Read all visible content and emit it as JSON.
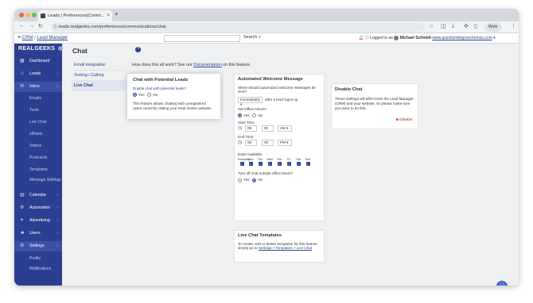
{
  "browser": {
    "tab_title": "Leads | Preferences|Comm...",
    "url": "leads.realgeeks.com/preferences/communications/chat",
    "profile_label": "Work"
  },
  "topbar": {
    "breadcrumb_root": "CRM",
    "breadcrumb_page": "Lead Manager",
    "search_label": "Search",
    "logged_in_label": "Logged in as",
    "user_name": "Michael Schmidt",
    "website": "www.quicklandingnerchomes.com"
  },
  "sidebar": {
    "logo": "REALGEEKS",
    "items": [
      {
        "label": "Dashboard",
        "icon": "dashboard-icon",
        "glyph": "▦"
      },
      {
        "label": "Leads",
        "icon": "person-icon",
        "glyph": "☺"
      },
      {
        "label": "Inbox",
        "icon": "inbox-icon",
        "glyph": "✉"
      }
    ],
    "inbox_sub": [
      "Emails",
      "Texts",
      "Live Chat",
      "eBlasts",
      "Videos",
      "Postcards",
      "Templates",
      "Message Settings"
    ],
    "items2": [
      {
        "label": "Calendar",
        "icon": "calendar-icon",
        "glyph": "▤"
      },
      {
        "label": "Automation",
        "icon": "automation-icon",
        "glyph": "⚙"
      },
      {
        "label": "Advertising",
        "icon": "advertising-icon",
        "glyph": "✦"
      },
      {
        "label": "Users",
        "icon": "users-icon",
        "glyph": "☻"
      },
      {
        "label": "Settings",
        "icon": "settings-icon",
        "glyph": "⚙"
      }
    ],
    "settings_sub": [
      "Profile",
      "Notifications"
    ]
  },
  "page": {
    "title": "Chat",
    "how_text": "How does this all work? See our",
    "how_link": "Documentation",
    "how_tail": "on this feature.",
    "nav": [
      "Email Integration",
      "Texting / Calling",
      "Live Chat"
    ]
  },
  "popup": {
    "title": "Chat with Potential Leads",
    "question": "Enable chat with potential leads?",
    "yes": "Yes",
    "no": "No",
    "description": "This feature allows chatting with unregistered users currently visiting your Real Geeks website."
  },
  "auto_msg": {
    "title": "Automated Welcome Message",
    "question": "When should automated welcome messages be sent?",
    "select": "Immediately",
    "after_text": "after a lead signs up",
    "office_q": "Set Office Hours?",
    "yes": "Yes",
    "no": "No",
    "start_label": "Start Time",
    "end_label": "End Time",
    "start_h": "08",
    "start_m": "00",
    "start_ap": "AM",
    "end_h": "08",
    "end_m": "00",
    "end_ap": "PM",
    "days_label": "Days Available",
    "days": [
      "Everyday",
      "Mon",
      "Tue",
      "Wed",
      "Thu",
      "Fri",
      "Sat",
      "Sun"
    ],
    "turnoff_q": "Turn off chat outside office hours?"
  },
  "templates": {
    "title": "Live Chat Templates",
    "text": "To create, edit or delete templates for this feature simply go to",
    "link": "Settings > Templates > Live Chat"
  },
  "disable": {
    "title": "Disable Chat",
    "text": "These settings will affect both the Lead Manager (CRM) and your website, so please make sure you want to do this.",
    "button": "Disable"
  }
}
